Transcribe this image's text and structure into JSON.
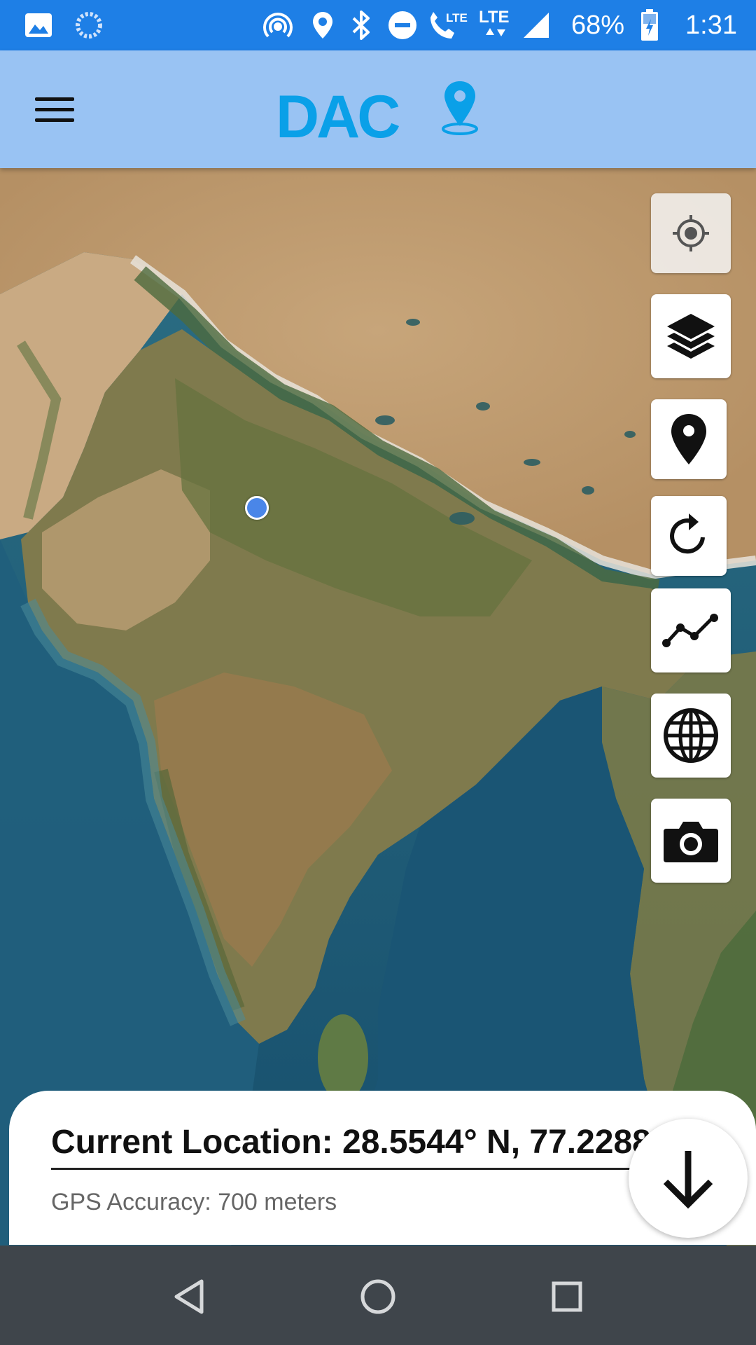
{
  "status_bar": {
    "battery": "68%",
    "time": "1:31",
    "lte_label_1": "LTE",
    "lte_label_2": "LTE",
    "icons": [
      "image-icon",
      "loading-icon",
      "hotspot-icon",
      "location-icon",
      "bluetooth-icon",
      "do-not-disturb-icon",
      "volte-call-icon",
      "lte-data-icon",
      "signal-icon",
      "battery-charging-icon"
    ]
  },
  "app_bar": {
    "logo_text": "DAC",
    "menu_icon": "hamburger-menu-icon"
  },
  "map": {
    "type": "satellite",
    "current_location_marker": "blue-dot"
  },
  "toolbar": {
    "buttons": [
      {
        "name": "my-location-button",
        "icon": "crosshair-icon"
      },
      {
        "name": "layers-button",
        "icon": "layers-icon"
      },
      {
        "name": "drop-pin-button",
        "icon": "map-pin-icon"
      },
      {
        "name": "refresh-button",
        "icon": "refresh-icon"
      },
      {
        "name": "track-path-button",
        "icon": "polyline-icon"
      },
      {
        "name": "globe-button",
        "icon": "globe-icon"
      },
      {
        "name": "camera-button",
        "icon": "camera-icon"
      }
    ]
  },
  "location_card": {
    "title": "Current Location: 28.5544° N, 77.2288° E",
    "accuracy": "GPS Accuracy: 700 meters",
    "collapse_icon": "arrow-down-icon"
  },
  "nav_bar": {
    "icons": [
      "back-icon",
      "home-icon",
      "recents-icon"
    ]
  },
  "colors": {
    "status_bar": "#1e7fe6",
    "app_bar": "#99c3f3",
    "logo": "#0aa0e8",
    "nav_bar": "#3f454b",
    "location_dot": "#4a86e8"
  }
}
